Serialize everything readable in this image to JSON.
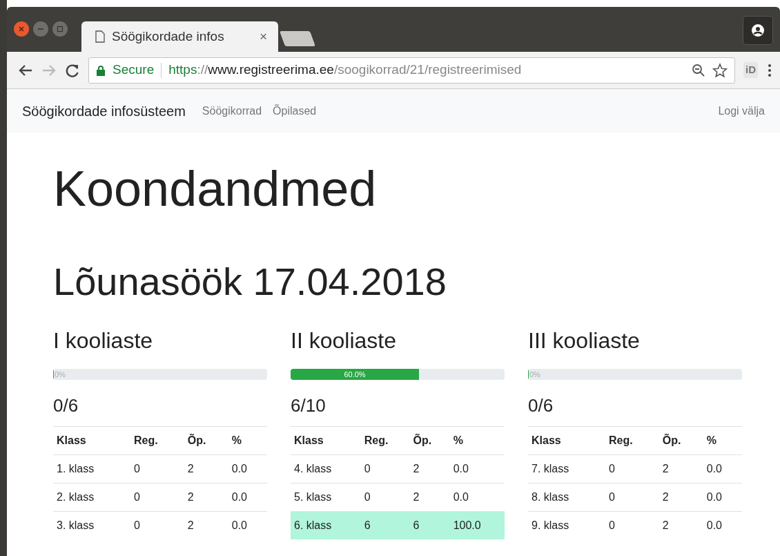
{
  "browser": {
    "tab_title": "Söögikordade infos",
    "close": "×",
    "secure_label": "Secure",
    "url": {
      "scheme": "https",
      "separator": "://",
      "host": "www.registreerima.ee",
      "path": "/soogikorrad/21/registreerimised"
    },
    "extension": "iD"
  },
  "navbar": {
    "brand": "Söögikordade infosüsteem",
    "links": [
      {
        "label": "Söögikorrad"
      },
      {
        "label": "Õpilased"
      }
    ],
    "logout": "Logi välja"
  },
  "title": "Koondandmed",
  "meal": "Lõunasöök 17.04.2018",
  "levels": [
    {
      "name": "I kooliaste",
      "level": 0,
      "progress_label": "0%",
      "count": "0/6",
      "columns": [
        "Klass",
        "Reg.",
        "Õp.",
        "%"
      ],
      "rows": [
        {
          "cells": [
            "1. klass",
            "0",
            "2",
            "0.0"
          ],
          "highlighted": false
        },
        {
          "cells": [
            "2. klass",
            "0",
            "2",
            "0.0"
          ],
          "highlighted": false
        },
        {
          "cells": [
            "3. klass",
            "0",
            "2",
            "0.0"
          ],
          "highlighted": false
        }
      ]
    },
    {
      "name": "II kooliaste",
      "level": 0.6,
      "progress_label": "60.0%",
      "count": "6/10",
      "columns": [
        "Klass",
        "Reg.",
        "Õp.",
        "%"
      ],
      "rows": [
        {
          "cells": [
            "4. klass",
            "0",
            "2",
            "0.0"
          ],
          "highlighted": false
        },
        {
          "cells": [
            "5. klass",
            "0",
            "2",
            "0.0"
          ],
          "highlighted": false
        },
        {
          "cells": [
            "6. klass",
            "6",
            "6",
            "100.0"
          ],
          "highlighted": true
        }
      ]
    },
    {
      "name": "III kooliaste",
      "level": 0,
      "progress_label": "0%",
      "count": "0/6",
      "columns": [
        "Klass",
        "Reg.",
        "Õp.",
        "%"
      ],
      "rows": [
        {
          "cells": [
            "7. klass",
            "0",
            "2",
            "0.0"
          ],
          "highlighted": false
        },
        {
          "cells": [
            "8. klass",
            "0",
            "2",
            "0.0"
          ],
          "highlighted": false
        },
        {
          "cells": [
            "9. klass",
            "0",
            "2",
            "0.0"
          ],
          "highlighted": false
        }
      ]
    }
  ]
}
